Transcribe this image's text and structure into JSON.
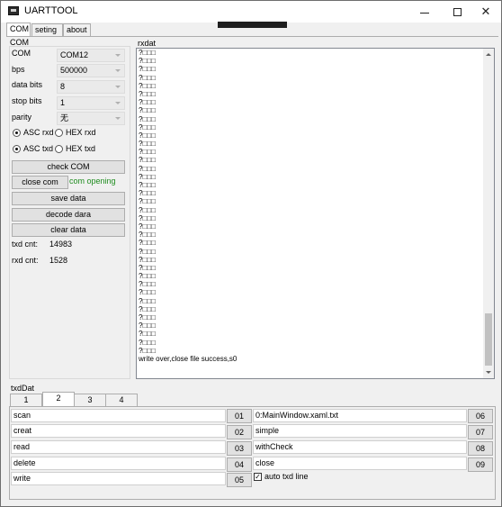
{
  "window": {
    "title": "UARTTOOL"
  },
  "tabs": [
    {
      "label": "COM",
      "active": true
    },
    {
      "label": "seting",
      "active": false
    },
    {
      "label": "about",
      "active": false
    }
  ],
  "com_group": {
    "title": "COM",
    "fields": [
      {
        "label": "COM",
        "value": "COM12"
      },
      {
        "label": "bps",
        "value": "500000"
      },
      {
        "label": "data bits",
        "value": "8"
      },
      {
        "label": "stop bits",
        "value": "1"
      },
      {
        "label": "parity",
        "value": "无"
      }
    ],
    "rx_mode": {
      "asc_label": "ASC rxd",
      "hex_label": "HEX rxd",
      "selected": "ASC"
    },
    "tx_mode": {
      "asc_label": "ASC txd",
      "hex_label": "HEX txd",
      "selected": "ASC"
    },
    "buttons": {
      "check_com": "check COM",
      "close_com": "close com",
      "save_data": "save data",
      "decode_data": "decode dara",
      "clear_data": "clear data"
    },
    "status": "com opening",
    "status_color": "#1e8c1e",
    "txd_cnt_label": "txd cnt:",
    "txd_cnt": "14983",
    "rxd_cnt_label": "rxd cnt:",
    "rxd_cnt": "1528"
  },
  "rxdat": {
    "title": "rxdat",
    "lines": [
      "?□□□",
      "?□□□",
      "?□□□",
      "?□□□",
      "?□□□",
      "?□□□",
      "?□□□",
      "?□□□",
      "?□□□",
      "?□□□",
      "?□□□",
      "?□□□",
      "?□□□",
      "?□□□",
      "?□□□",
      "?□□□",
      "?□□□",
      "?□□□",
      "?□□□",
      "?□□□",
      "?□□□",
      "?□□□",
      "?□□□",
      "?□□□",
      "?□□□",
      "?□□□",
      "?□□□",
      "?□□□",
      "?□□□",
      "?□□□",
      "?□□□",
      "?□□□",
      "?□□□",
      "?□□□",
      "?□□□",
      "?□□□",
      "?□□□",
      "write over,close file success,s0"
    ]
  },
  "txddat": {
    "title": "txdDat",
    "subtabs": [
      {
        "label": "1",
        "active": false
      },
      {
        "label": "2",
        "active": true
      },
      {
        "label": "3",
        "active": false
      },
      {
        "label": "4",
        "active": false
      }
    ],
    "left_rows": [
      {
        "text": "scan",
        "num": "01"
      },
      {
        "text": "creat",
        "num": "02"
      },
      {
        "text": "read",
        "num": "03"
      },
      {
        "text": "delete",
        "num": "04"
      },
      {
        "text": "write",
        "num": "05"
      }
    ],
    "right_rows": [
      {
        "text": "0:MainWindow.xaml.txt",
        "num": "06"
      },
      {
        "text": "simple",
        "num": "07"
      },
      {
        "text": "withCheck",
        "num": "08"
      },
      {
        "text": "close",
        "num": "09"
      }
    ],
    "auto_txd_line": {
      "label": "auto txd line",
      "checked": true
    }
  }
}
